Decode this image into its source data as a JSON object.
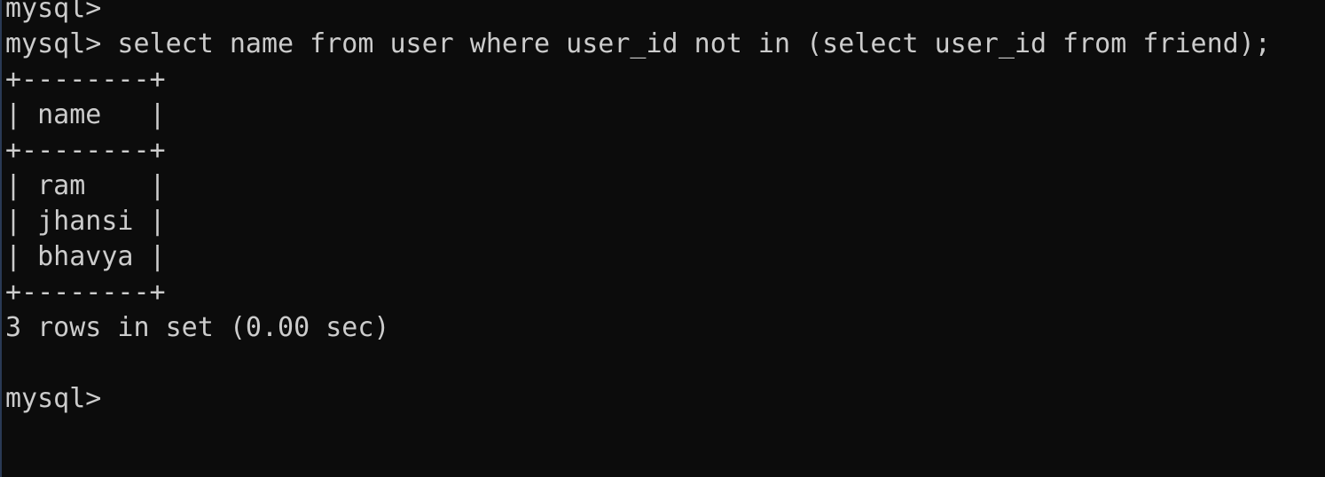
{
  "terminal": {
    "lines": [
      "mysql>",
      "mysql> select name from user where user_id not in (select user_id from friend);",
      "+--------+",
      "| name   |",
      "+--------+",
      "| ram    |",
      "| jhansi |",
      "| bhavya |",
      "+--------+",
      "3 rows in set (0.00 sec)",
      "",
      "mysql>"
    ]
  },
  "colors": {
    "background": "#0c0c0c",
    "text": "#cccccc"
  }
}
